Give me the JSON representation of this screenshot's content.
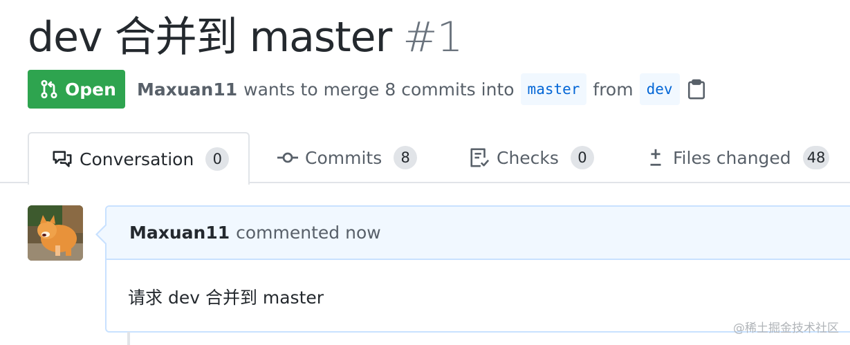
{
  "pr": {
    "title": "dev 合并到 master",
    "number": "#1",
    "state_label": "Open",
    "author": "Maxuan11",
    "merge_text_before": "wants to merge 8 commits into",
    "base_branch": "master",
    "from_text": "from",
    "head_branch": "dev"
  },
  "tabs": [
    {
      "label": "Conversation",
      "count": "0",
      "icon": "comment-discussion-icon",
      "selected": true
    },
    {
      "label": "Commits",
      "count": "8",
      "icon": "git-commit-icon"
    },
    {
      "label": "Checks",
      "count": "0",
      "icon": "checklist-icon"
    },
    {
      "label": "Files changed",
      "count": "48",
      "icon": "diff-icon"
    }
  ],
  "comment": {
    "author": "Maxuan11",
    "action": "commented now",
    "body": "请求 dev 合并到 master"
  },
  "colors": {
    "open_green": "#2ea44f",
    "link_blue": "#0366d6",
    "comment_border": "#c8e1ff",
    "comment_header_bg": "#f1f8ff"
  },
  "watermark": "@稀土掘金技术社区"
}
